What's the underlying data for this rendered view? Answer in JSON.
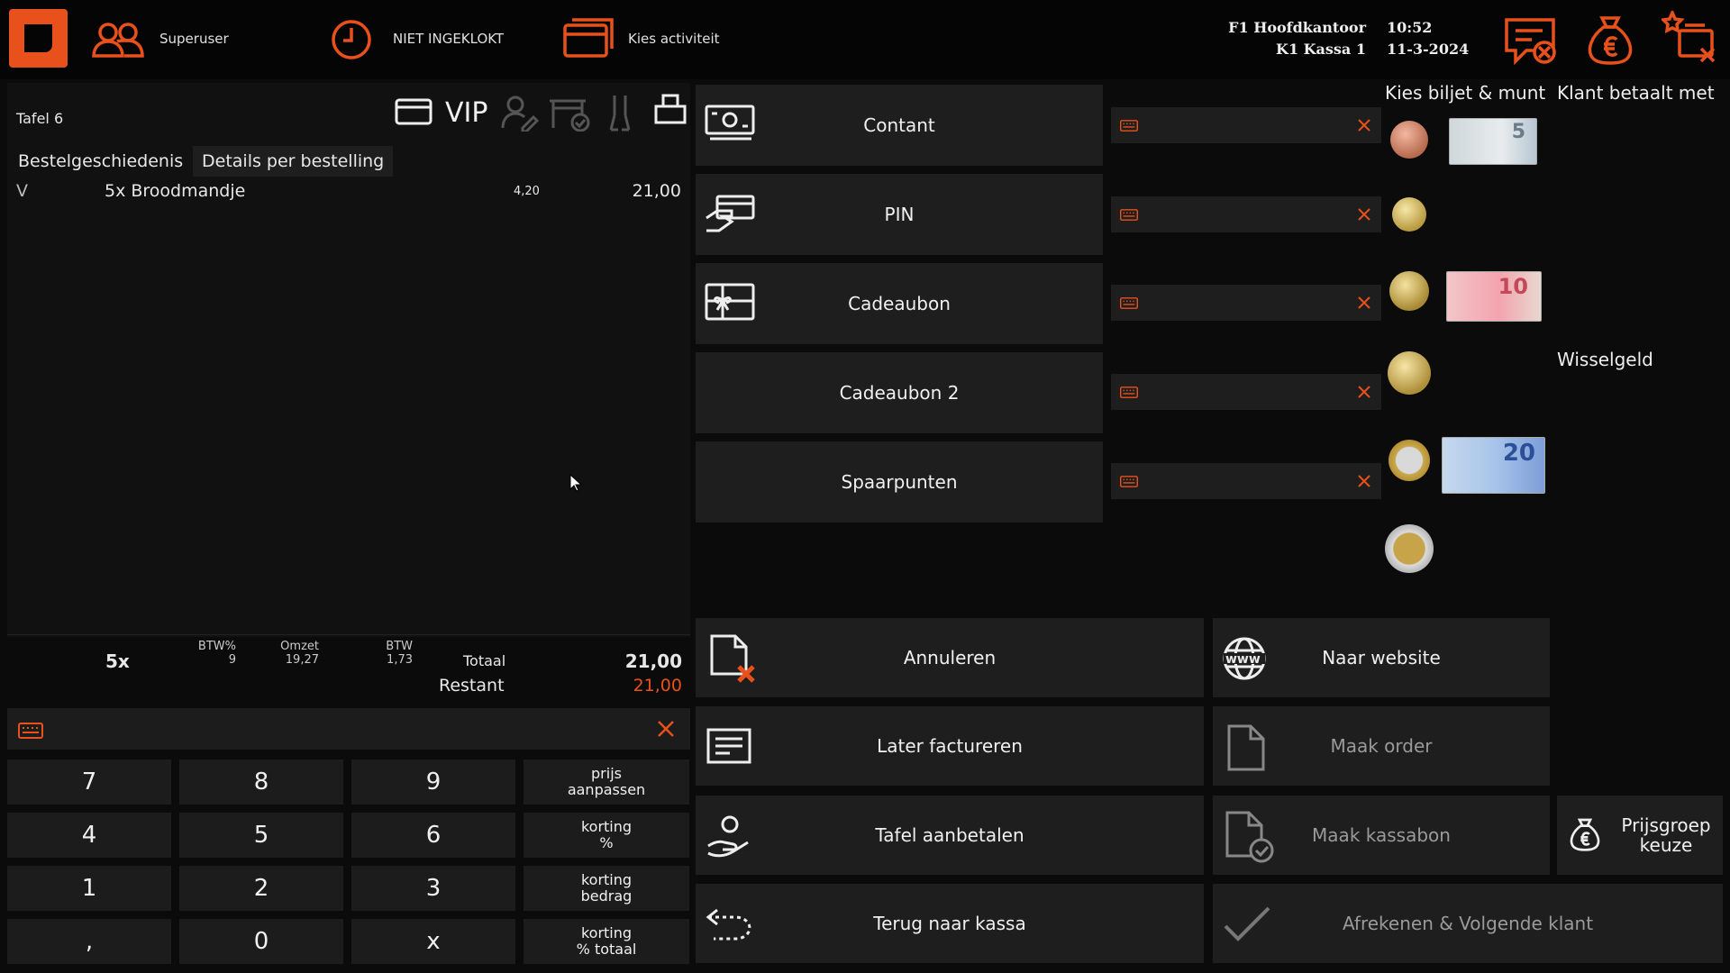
{
  "topbar": {
    "user": "Superuser",
    "clock_status": "NIET INGEKLOKT",
    "activity": "Kies activiteit",
    "location1": "F1 Hoofdkantoor",
    "location2": "K1 Kassa 1",
    "time": "10:52",
    "date": "11-3-2024"
  },
  "order": {
    "table": "Tafel 6",
    "vip": "VIP",
    "tabs": [
      "Bestelgeschiedenis",
      "Details per bestelling"
    ],
    "lines": [
      {
        "flag": "V",
        "desc": "5x Broodmandje",
        "unit": "4,20",
        "total": "21,00"
      }
    ],
    "summary": {
      "count": "5x",
      "btw_pct_label": "BTW%",
      "btw_pct": "9",
      "omzet_label": "Omzet",
      "omzet": "19,27",
      "btw_label": "BTW",
      "btw": "1,73",
      "totaal_label": "Totaal",
      "totaal": "21,00",
      "restant_label": "Restant",
      "restant": "21,00"
    }
  },
  "keypad": {
    "keys": [
      "7",
      "8",
      "9",
      "4",
      "5",
      "6",
      "1",
      "2",
      "3",
      ",",
      "0",
      "x"
    ],
    "side": [
      [
        "prijs",
        "aanpassen"
      ],
      [
        "korting",
        "%"
      ],
      [
        "korting",
        "bedrag"
      ],
      [
        "korting",
        "% totaal"
      ]
    ]
  },
  "payment_methods": [
    "Contant",
    "PIN",
    "Cadeaubon",
    "Cadeaubon 2",
    "Spaarpunten"
  ],
  "money": {
    "header_left": "Kies biljet & munt",
    "header_right": "Klant betaalt met",
    "change_label": "Wisselgeld",
    "note_5": "5",
    "note_10": "10",
    "note_20": "20"
  },
  "actions": {
    "annuleren": "Annuleren",
    "website": "Naar website",
    "later": "Later factureren",
    "order": "Maak order",
    "tafel": "Tafel aanbetalen",
    "kassabon": "Maak kassabon",
    "prijsgroep": [
      "Prijsgroep",
      "keuze"
    ],
    "terug": "Terug naar kassa",
    "afrekenen": "Afrekenen & Volgende klant",
    "www": "www"
  },
  "colors": {
    "accent": "#e8501c",
    "panel": "#1e1e1e",
    "background": "#0b0b0b"
  }
}
